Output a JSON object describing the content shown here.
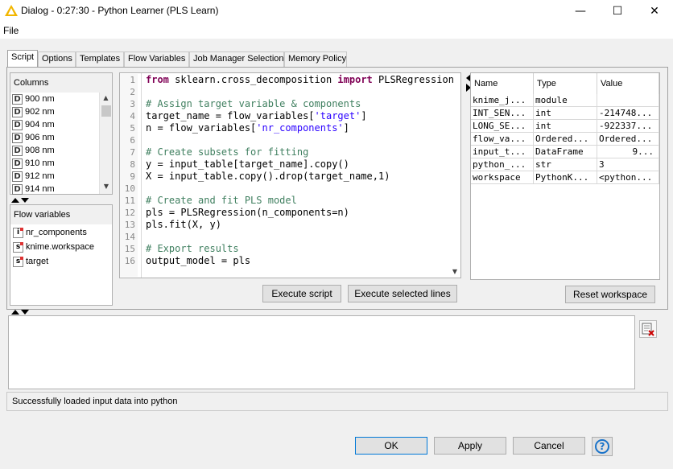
{
  "window": {
    "title": "Dialog - 0:27:30 - Python Learner (PLS Learn)",
    "minimize_glyph": "—",
    "maximize_glyph": "☐",
    "close_glyph": "✕"
  },
  "menu": {
    "file": "File"
  },
  "tabs": [
    "Script",
    "Options",
    "Templates",
    "Flow Variables",
    "Job Manager Selection",
    "Memory Policy"
  ],
  "columns": {
    "header": "Columns",
    "type_icon": "D",
    "items": [
      "900 nm",
      "902 nm",
      "904 nm",
      "906 nm",
      "908 nm",
      "910 nm",
      "912 nm",
      "914 nm"
    ]
  },
  "flow_variables": {
    "header": "Flow variables",
    "items": [
      {
        "icon": "i",
        "name": "nr_components"
      },
      {
        "icon": "s",
        "name": "knime.workspace"
      },
      {
        "icon": "s",
        "name": "target"
      }
    ]
  },
  "editor": {
    "line_numbers": [
      "1",
      "2",
      "3",
      "4",
      "5",
      "6",
      "7",
      "8",
      "9",
      "10",
      "11",
      "12",
      "13",
      "14",
      "15",
      "16"
    ],
    "execute_script": "Execute script",
    "execute_selected": "Execute selected lines"
  },
  "workspace": {
    "headers": [
      "Name",
      "Type",
      "Value"
    ],
    "rows": [
      [
        "knime_j...",
        "module",
        ""
      ],
      [
        "INT_SEN...",
        "int",
        "-214748..."
      ],
      [
        "LONG_SE...",
        "int",
        "-922337..."
      ],
      [
        "flow_va...",
        "Ordered...",
        "Ordered..."
      ],
      [
        "input_t...",
        "DataFrame",
        "9..."
      ],
      [
        "python_...",
        "str",
        "3"
      ],
      [
        "workspace",
        "PythonK...",
        "<python..."
      ]
    ],
    "reset": "Reset workspace"
  },
  "status": "Successfully loaded input data into python",
  "buttons": {
    "ok": "OK",
    "apply": "Apply",
    "cancel": "Cancel",
    "help": "?"
  },
  "colors": {
    "keyword": "#7f0055",
    "string": "#2a00ff",
    "comment": "#3f7f5f",
    "accent": "#0078d7"
  }
}
